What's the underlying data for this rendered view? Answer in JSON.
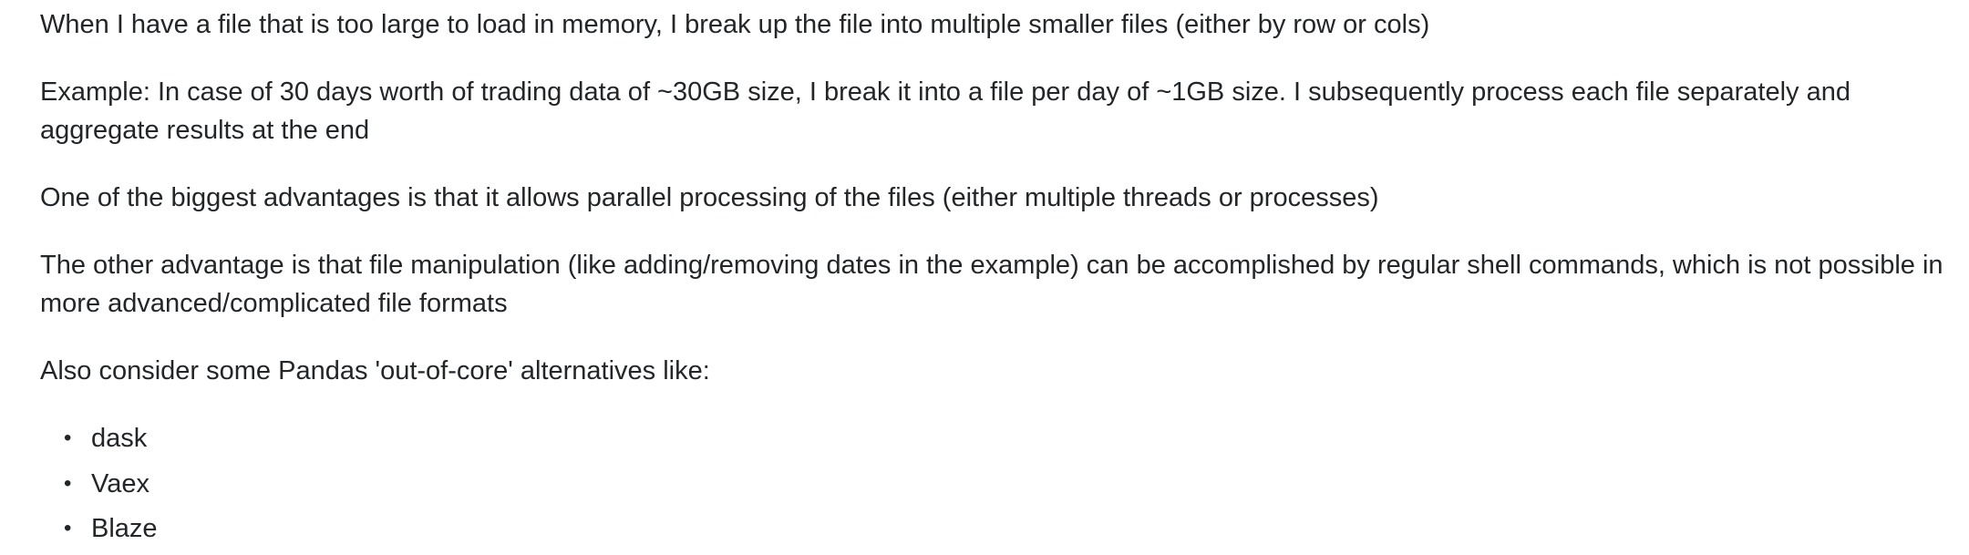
{
  "post": {
    "paragraphs": [
      "When I have a file that is too large to load in memory, I break up the file into multiple smaller files (either by row or cols)",
      "Example: In case of 30 days worth of trading data of ~30GB size, I break it into a file per day of ~1GB size. I subsequently process each file separately and aggregate results at the end",
      "One of the biggest advantages is that it allows parallel processing of the files (either multiple threads or processes)",
      "The other advantage is that file manipulation (like adding/removing dates in the example) can be accomplished by regular shell commands, which is not possible in more advanced/complicated file formats",
      "Also consider some Pandas 'out-of-core' alternatives like:"
    ],
    "list_items": [
      "dask",
      "Vaex",
      "Blaze"
    ],
    "bullet_glyph": "•"
  }
}
